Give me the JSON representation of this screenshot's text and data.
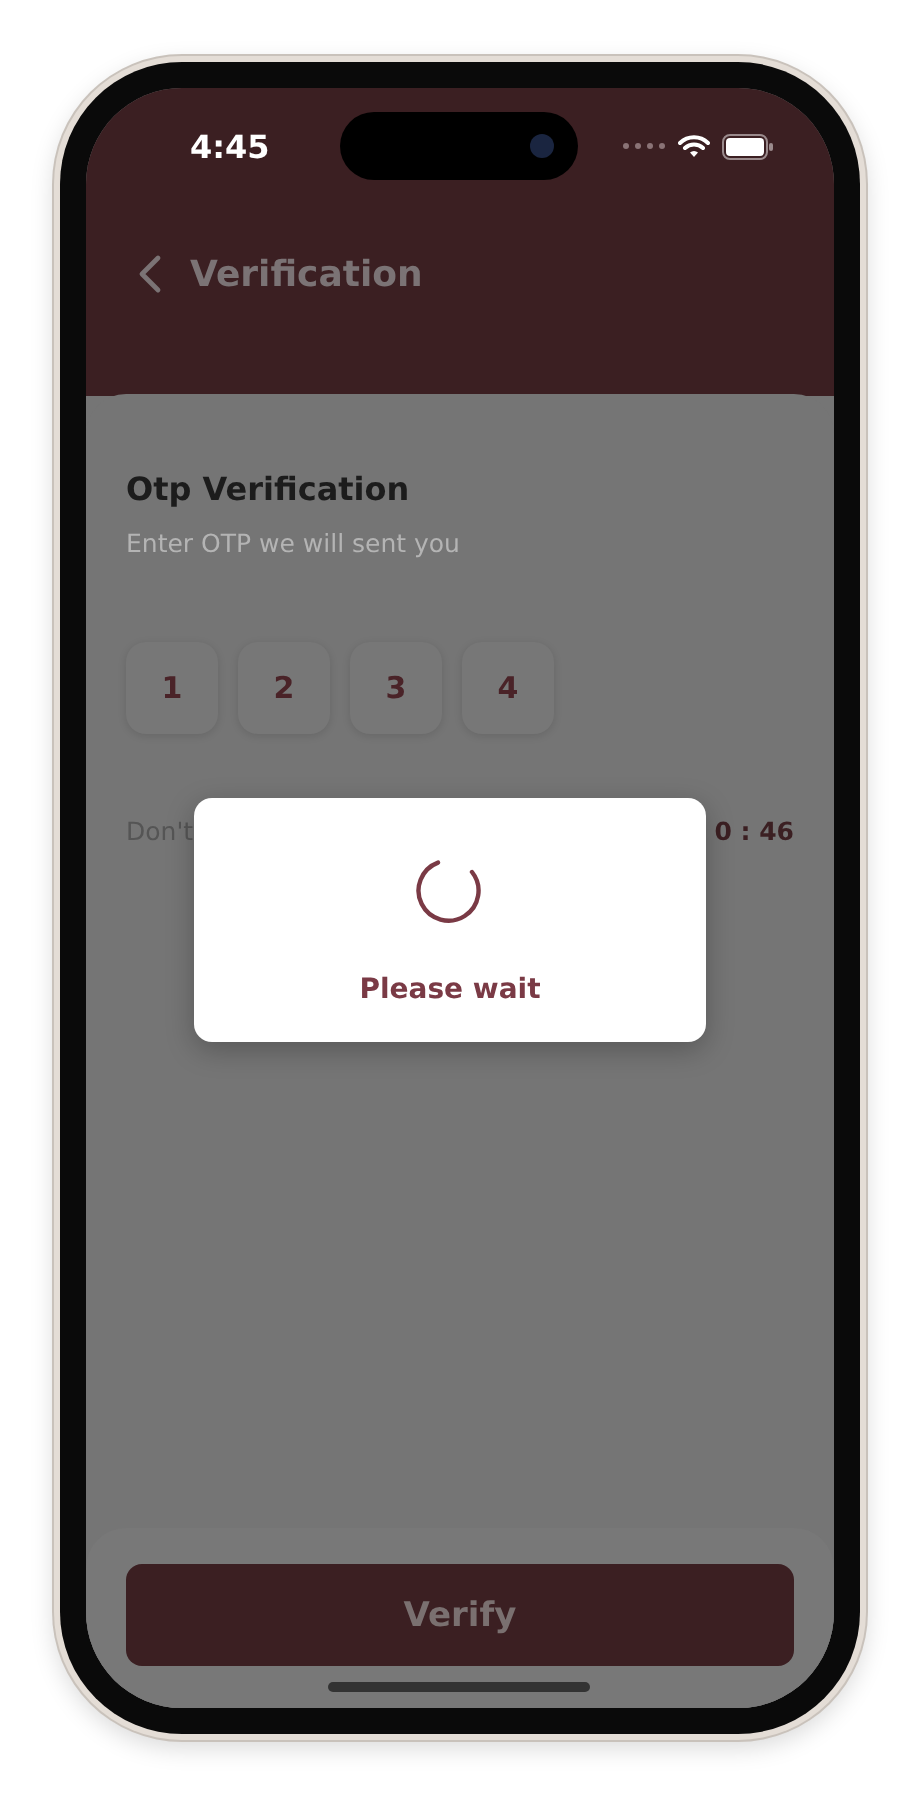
{
  "status_bar": {
    "time": "4:45"
  },
  "header": {
    "title": "Verification"
  },
  "otp": {
    "title": "Otp Verification",
    "subtitle": "Enter OTP we will sent you",
    "digits": [
      "1",
      "2",
      "3",
      "4"
    ],
    "resend_prefix": "Don't",
    "timer": "0 : 46"
  },
  "verify_button": {
    "label": "Verify"
  },
  "dialog": {
    "message": "Please wait"
  }
}
